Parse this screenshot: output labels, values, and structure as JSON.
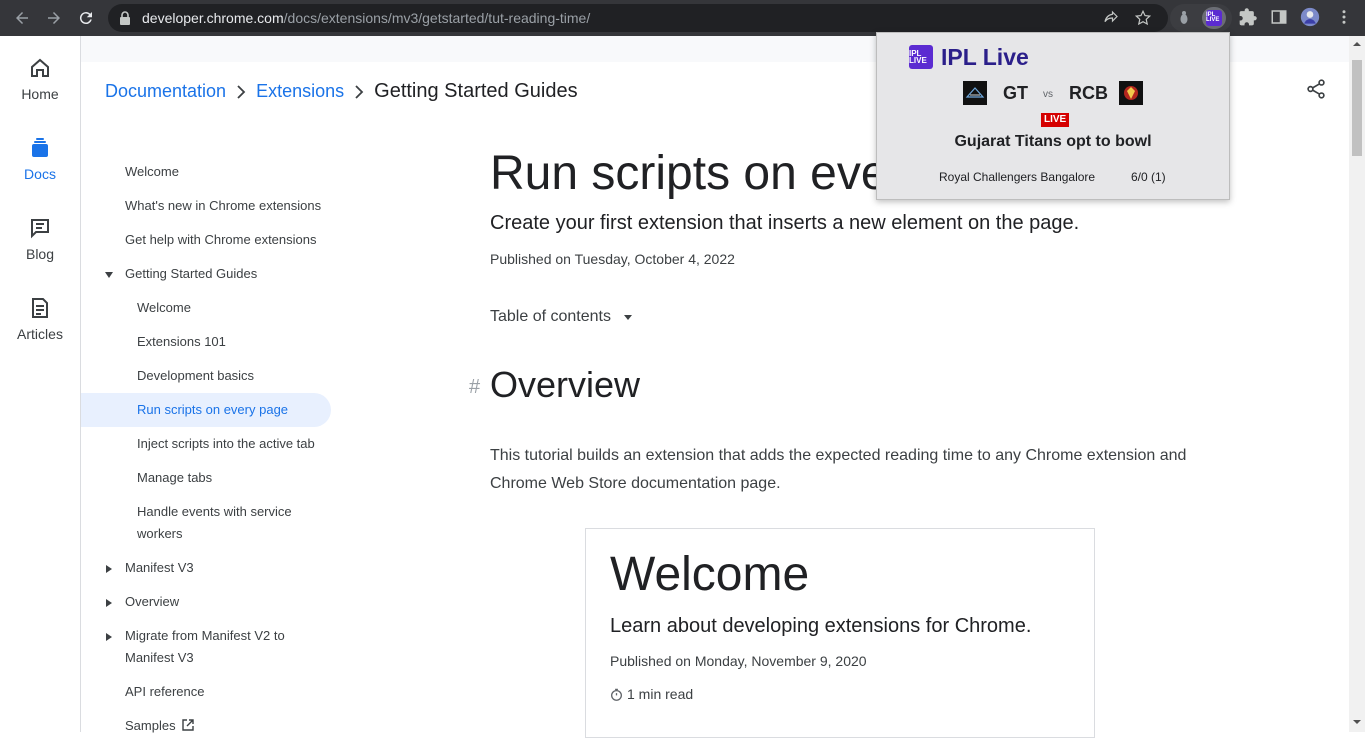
{
  "browser": {
    "url_host": "developer.chrome.com",
    "url_path": "/docs/extensions/mv3/getstarted/tut-reading-time/",
    "extension_badge": "IPL LIVE",
    "accent_color": "#1a73e8"
  },
  "rail": {
    "items": [
      {
        "label": "Home",
        "icon": "home-icon"
      },
      {
        "label": "Docs",
        "icon": "docs-icon",
        "active": true
      },
      {
        "label": "Blog",
        "icon": "blog-icon"
      },
      {
        "label": "Articles",
        "icon": "articles-icon"
      }
    ]
  },
  "breadcrumb": {
    "items": [
      "Documentation",
      "Extensions"
    ],
    "current": "Getting Started Guides"
  },
  "sidenav": {
    "items": [
      {
        "label": "Welcome"
      },
      {
        "label": "What's new in Chrome extensions"
      },
      {
        "label": "Get help with Chrome extensions"
      },
      {
        "label": "Getting Started Guides",
        "expanded": true
      },
      {
        "label": "Welcome"
      },
      {
        "label": "Extensions 101"
      },
      {
        "label": "Development basics"
      },
      {
        "label": "Run scripts on every page",
        "active": true
      },
      {
        "label": "Inject scripts into the active tab"
      },
      {
        "label": "Manage tabs"
      },
      {
        "label": "Handle events with service"
      },
      {
        "label": "workers"
      },
      {
        "label": "Manifest V3",
        "expanded": false
      },
      {
        "label": "Overview",
        "expanded": false
      },
      {
        "label": "Migrate from Manifest V2 to",
        "expanded": false
      },
      {
        "label": "Manifest V3"
      },
      {
        "label": "API reference"
      },
      {
        "label": "Samples"
      }
    ]
  },
  "article": {
    "title": "Run scripts on eve",
    "subtitle": "Create your first extension that inserts a new element on the page.",
    "published": "Published on Tuesday, October 4, 2022",
    "toc_label": "Table of contents",
    "section_anchor": "#",
    "section_title": "Overview",
    "paragraph": "This tutorial builds an extension that adds the expected reading time to any Chrome extension and Chrome Web Store documentation page."
  },
  "card": {
    "title": "Welcome",
    "subtitle": "Learn about developing extensions for Chrome.",
    "published": "Published on Monday, November 9, 2020",
    "read_time": "1 min read"
  },
  "popup": {
    "badge": "IPL LIVE",
    "title": "IPL Live",
    "team1": "GT",
    "vs": "vs",
    "team2": "RCB",
    "live_label": "LIVE",
    "status": "Gujarat Titans opt to bowl",
    "batting_team": "Royal Challengers Bangalore",
    "score": "6/0 (1)"
  }
}
